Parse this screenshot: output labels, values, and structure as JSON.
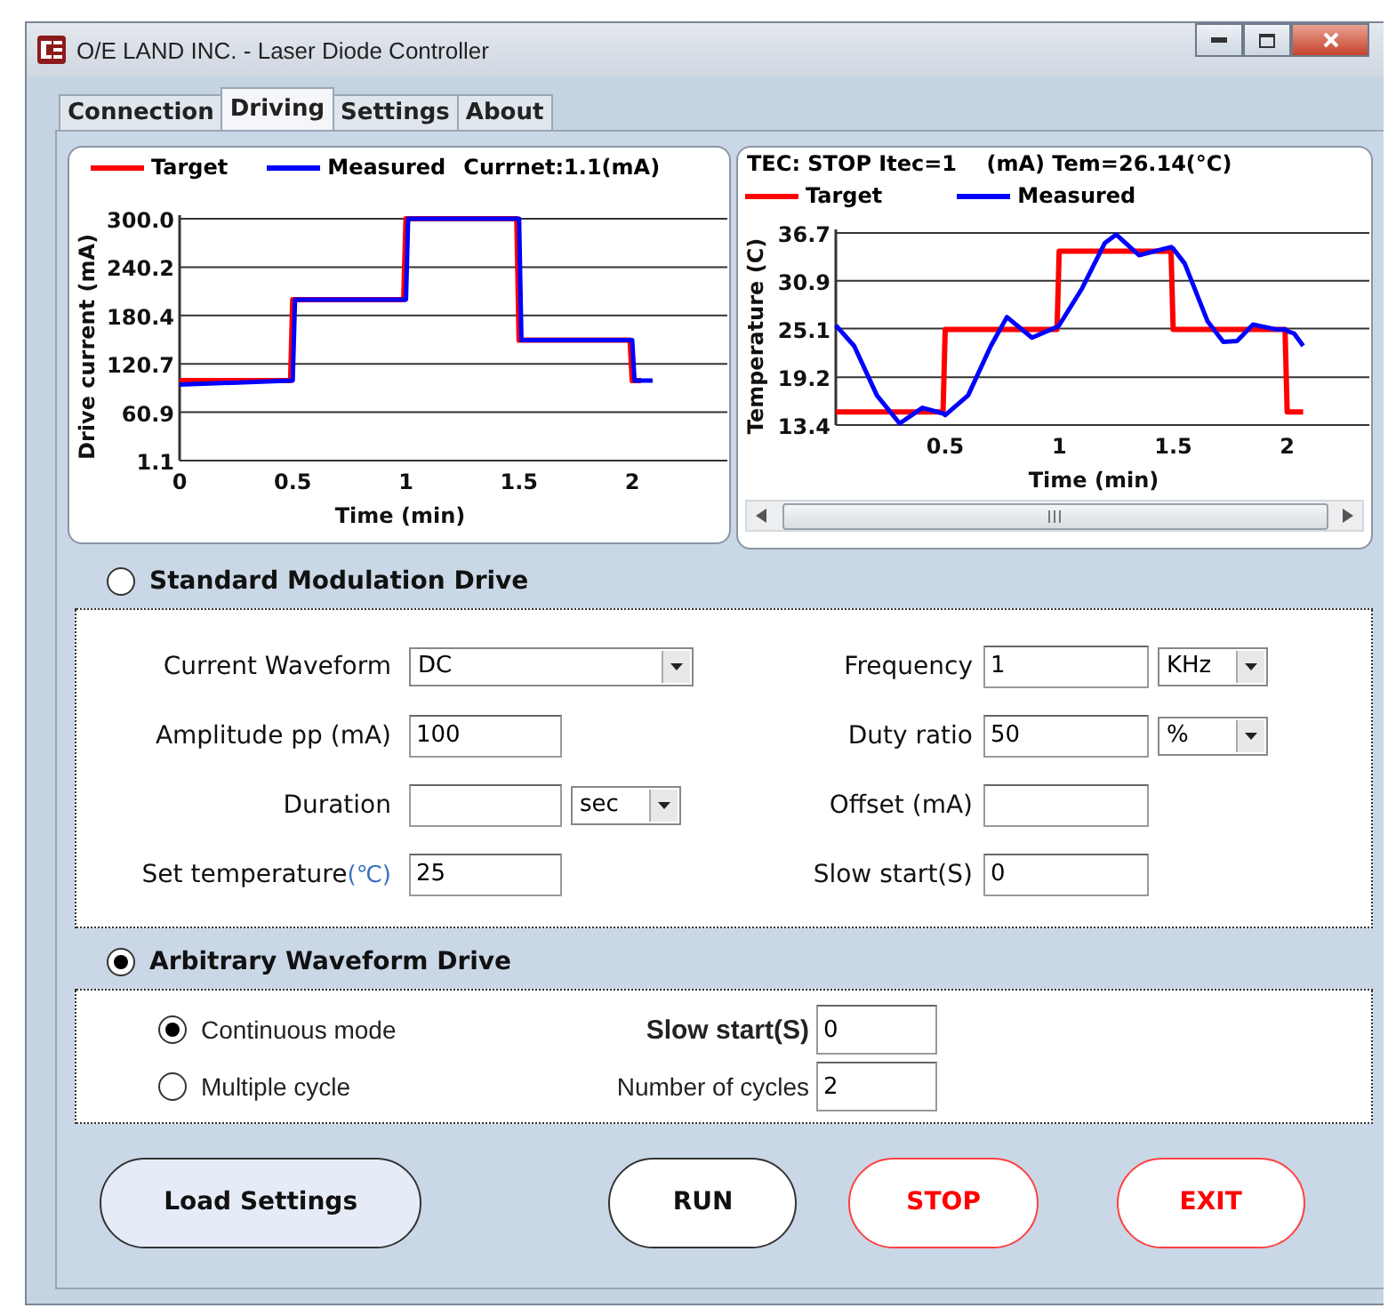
{
  "window": {
    "title": "O/E LAND INC. - Laser Diode Controller"
  },
  "tabs": [
    {
      "label": "Connection",
      "selected": false
    },
    {
      "label": "Driving",
      "selected": true
    },
    {
      "label": "Settings",
      "selected": false
    },
    {
      "label": "About",
      "selected": false
    }
  ],
  "current_chart": {
    "reading": "Currnet:1.1(mA)",
    "chart_data": {
      "type": "line",
      "xlabel": "Time (min)",
      "ylabel": "Drive current (mA)",
      "x": [
        0,
        0.49,
        0.5,
        0.51,
        0.99,
        1,
        1.01,
        1.49,
        1.5,
        1.51,
        1.99,
        2,
        2.01,
        2.04,
        2.09
      ],
      "series": [
        {
          "name": "Target",
          "color": "#ff0000",
          "values": [
            100,
            100,
            200,
            200,
            200,
            300,
            300,
            300,
            150,
            150,
            150,
            100,
            100,
            100,
            null
          ]
        },
        {
          "name": "Measured",
          "color": "#0000ff",
          "values": [
            95,
            100,
            100,
            200,
            200,
            200,
            300,
            300,
            300,
            150,
            150,
            150,
            100,
            100,
            100
          ]
        }
      ],
      "grid": true,
      "xlim": [
        0,
        2.42
      ],
      "ylim": [
        1.1,
        300
      ],
      "xticks": [
        0,
        0.5,
        1,
        1.5,
        2
      ],
      "yticks": [
        {
          "value": 1.1,
          "label": "1.1"
        },
        {
          "value": 60.9,
          "label": "60.9"
        },
        {
          "value": 120.7,
          "label": "120.7"
        },
        {
          "value": 180.4,
          "label": "180.4"
        },
        {
          "value": 240.2,
          "label": "240.2"
        },
        {
          "value": 300,
          "label": "300.0"
        }
      ]
    }
  },
  "temperature_chart": {
    "status": "TEC: STOP Itec=1    (mA) Tem=26.14(°C)",
    "chart_data": {
      "type": "line",
      "xlabel": "Time (min)",
      "ylabel": "Temperature (C)",
      "x": [
        0.02,
        0.1,
        0.2,
        0.3,
        0.4,
        0.49,
        0.5,
        0.6,
        0.7,
        0.77,
        0.88,
        0.99,
        1,
        1.1,
        1.2,
        1.25,
        1.35,
        1.49,
        1.5,
        1.55,
        1.65,
        1.72,
        1.78,
        1.85,
        1.95,
        1.99,
        2,
        2.03,
        2.07
      ],
      "series": [
        {
          "name": "Target",
          "color": "#ff0000",
          "values": [
            15,
            15,
            15,
            15,
            15,
            15,
            25,
            25,
            25,
            25,
            25,
            25,
            34.5,
            34.5,
            34.5,
            34.5,
            34.5,
            34.5,
            25,
            25,
            25,
            25,
            25,
            25,
            25,
            25,
            15,
            15,
            15
          ]
        },
        {
          "name": "Measured",
          "color": "#0000ff",
          "values": [
            25.5,
            23,
            17,
            13.6,
            15.5,
            14.8,
            14.6,
            17,
            23,
            26.5,
            24,
            25.3,
            25.5,
            30,
            35.5,
            36.5,
            34,
            35,
            34.8,
            33,
            26,
            23.5,
            23.6,
            25.6,
            25,
            25,
            24.8,
            24.5,
            23
          ]
        }
      ],
      "grid": true,
      "xlim": [
        0.02,
        2.36
      ],
      "ylim": [
        13.4,
        36.7
      ],
      "xticks": [
        0.5,
        1,
        1.5,
        2
      ],
      "yticks": [
        {
          "value": 13.4,
          "label": "13.4"
        },
        {
          "value": 19.2,
          "label": "19.2"
        },
        {
          "value": 25.1,
          "label": "25.1"
        },
        {
          "value": 30.9,
          "label": "30.9"
        },
        {
          "value": 36.7,
          "label": "36.7"
        }
      ]
    }
  },
  "standard_drive": {
    "label": "Standard Modulation Drive",
    "selected": false,
    "fields": [
      {
        "label": "Current Waveform",
        "kind": "select",
        "value": "DC"
      },
      {
        "label": "Frequency",
        "kind": "input",
        "value": "1",
        "unit": "KHz"
      },
      {
        "label": "Amplitude pp (mA)",
        "kind": "input",
        "value": "100"
      },
      {
        "label": "Duty ratio",
        "kind": "input",
        "value": "50",
        "unit": "%"
      },
      {
        "label": "Duration",
        "kind": "input",
        "unit": "sec"
      },
      {
        "label": "Offset (mA)",
        "kind": "input"
      },
      {
        "label": "Set temperature",
        "label_suffix": "(℃)",
        "kind": "input",
        "value": "25"
      },
      {
        "label": "Slow start(S)",
        "kind": "input",
        "value": "0"
      }
    ]
  },
  "arbitrary_drive": {
    "label": "Arbitrary Waveform Drive",
    "selected": true,
    "modes": [
      {
        "label": "Continuous mode",
        "selected": true
      },
      {
        "label": "Multiple cycle",
        "selected": false
      }
    ],
    "fields": [
      {
        "label": "Slow start(S)",
        "value": "0"
      },
      {
        "label": "Number of cycles",
        "value": "2"
      }
    ]
  },
  "buttons": [
    {
      "label": "Load Settings",
      "kind": "secondary"
    },
    {
      "label": "RUN",
      "kind": "primary"
    },
    {
      "label": "STOP",
      "kind": "danger"
    },
    {
      "label": "EXIT",
      "kind": "danger"
    }
  ]
}
